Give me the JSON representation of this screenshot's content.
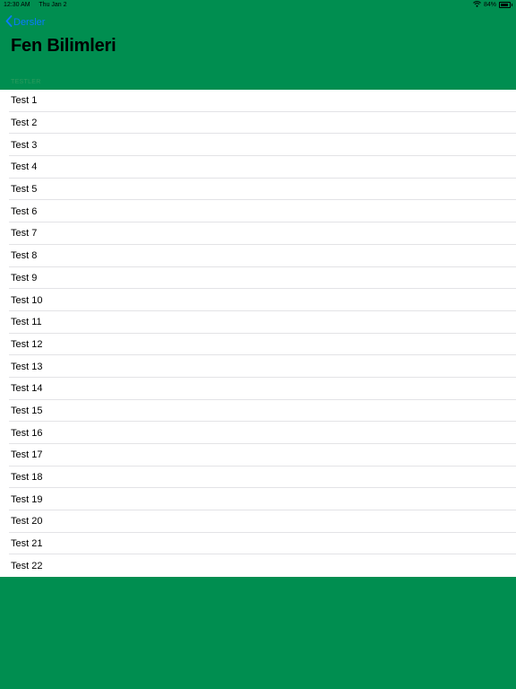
{
  "status_bar": {
    "time": "12:30 AM",
    "date": "Thu Jan 2",
    "battery_text": "84%",
    "battery_level": 0.84
  },
  "nav": {
    "back_label": "Dersler",
    "title": "Fen Bilimleri"
  },
  "section": {
    "header": "TESTLER"
  },
  "tests": [
    "Test 1",
    "Test 2",
    "Test 3",
    "Test 4",
    "Test 5",
    "Test 6",
    "Test 7",
    "Test 8",
    "Test 9",
    "Test 10",
    "Test 11",
    "Test 12",
    "Test 13",
    "Test 14",
    "Test 15",
    "Test 16",
    "Test 17",
    "Test 18",
    "Test 19",
    "Test 20",
    "Test 21",
    "Test 22"
  ],
  "colors": {
    "background": "#008e50",
    "accent": "#0a7aff",
    "list_background": "#ffffff"
  }
}
